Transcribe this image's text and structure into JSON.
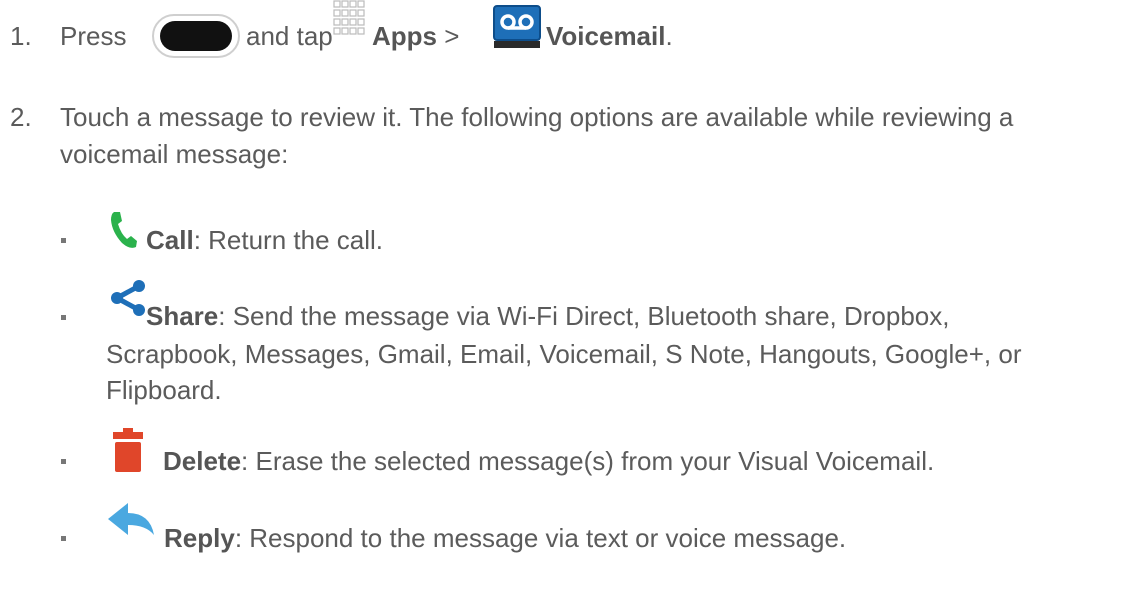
{
  "steps": [
    {
      "number": "1.",
      "press": "Press",
      "and_tap": "and tap",
      "apps": "Apps",
      "sep": ">",
      "voicemail": "Voicemail",
      "end": "."
    },
    {
      "number": "2.",
      "line1": "Touch a message to review it. The following options are available while reviewing a",
      "line2": "voicemail message:"
    }
  ],
  "options": [
    {
      "icon": "phone-icon",
      "label": "Call",
      "desc": ": Return the call."
    },
    {
      "icon": "share-icon",
      "label": "Share",
      "desc": ": Send the message via Wi-Fi Direct, Bluetooth share, Dropbox,",
      "line2": "Scrapbook, Messages, Gmail, Email, Voicemail, S Note, Hangouts, Google+, or",
      "line3": "Flipboard."
    },
    {
      "icon": "trash-icon",
      "label": "Delete",
      "desc": ": Erase the selected message(s) from your Visual Voicemail."
    },
    {
      "icon": "reply-icon",
      "label": "Reply",
      "desc": ": Respond to the message via text or voice message."
    }
  ],
  "colors": {
    "text": "#5b5b5b",
    "call": "#2bb24c",
    "share": "#1e6fb8",
    "delete": "#e0462a",
    "reply": "#4aa8e0"
  }
}
